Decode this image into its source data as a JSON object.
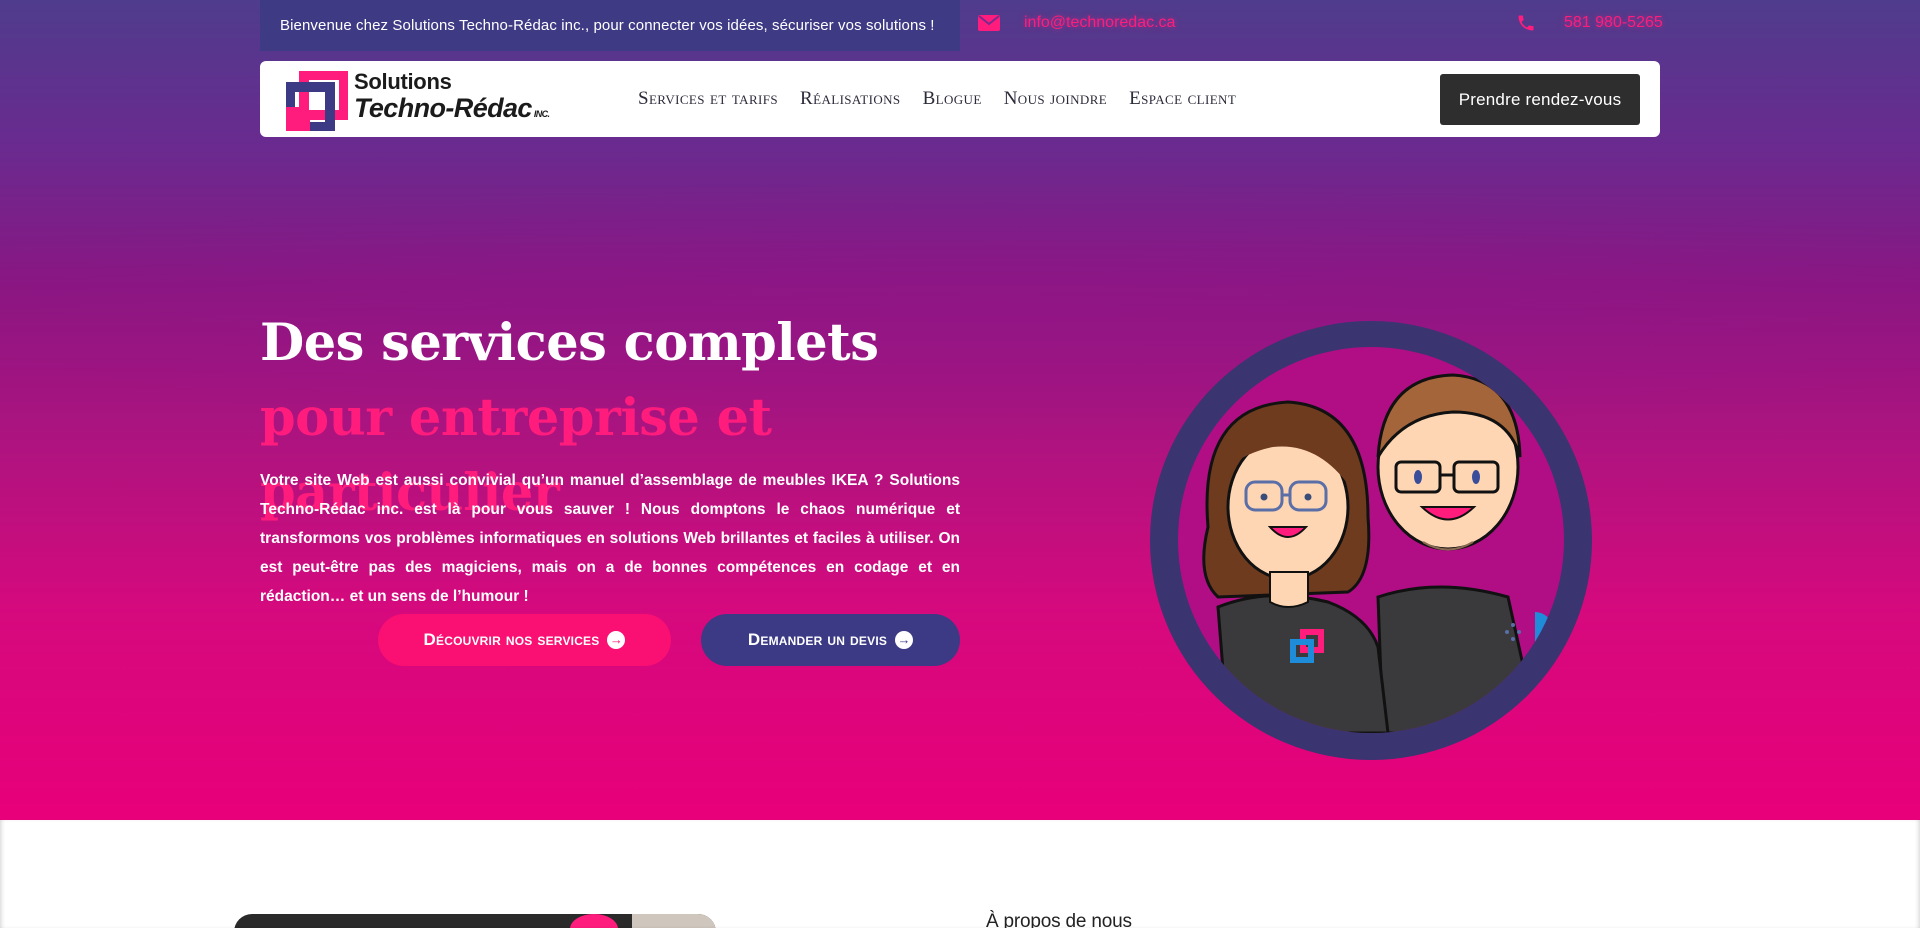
{
  "topbar": {
    "welcome": "Bienvenue chez Solutions Techno-Rédac inc., pour connecter vos idées, sécuriser vos solutions !",
    "email": "info@technoredac.ca",
    "phone": "581 980-5265",
    "email_icon": "envelope-icon",
    "phone_icon": "phone-icon"
  },
  "logo": {
    "line1": "Solutions",
    "line2": "Techno-Rédac",
    "suffix": "INC."
  },
  "nav": {
    "items": [
      {
        "label": "Services et tarifs"
      },
      {
        "label": "Réalisations"
      },
      {
        "label": "Blogue"
      },
      {
        "label": "Nous joindre"
      },
      {
        "label": "Espace client"
      }
    ],
    "cta": "Prendre rendez-vous"
  },
  "hero": {
    "title_white": "Des services complets",
    "title_accent": "pour entreprise et particulier",
    "paragraph": "Votre site Web est aussi convivial qu’un manuel d’assemblage de meubles IKEA ? Solutions Techno-Rédac inc. est là pour vous sauver ! Nous domptons le chaos numérique et transformons vos problèmes informatiques en solutions Web brillantes et faciles à utiliser. On est peut-être pas des magiciens, mais on a de bonnes compétences en codage et en rédaction… et un sens de l’humour !",
    "button_services": "Découvrir nos services",
    "button_devis": "Demander un devis"
  },
  "about": {
    "label": "À propos de nous"
  },
  "colors": {
    "accent_pink": "#fa0f73",
    "accent_indigo": "#3d3a85",
    "nav_button": "#2e2e2e"
  }
}
